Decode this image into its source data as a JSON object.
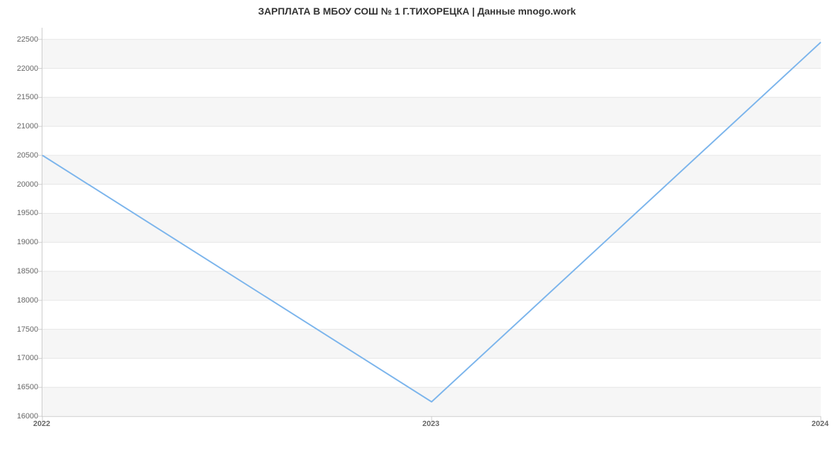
{
  "chart_data": {
    "type": "line",
    "title": "ЗАРПЛАТА В МБОУ СОШ № 1 Г.ТИХОРЕЦКА | Данные mnogo.work",
    "x": [
      2022,
      2023,
      2024
    ],
    "values": [
      20500,
      16250,
      22450
    ],
    "xlabel": "",
    "ylabel": "",
    "y_ticks": [
      16000,
      16500,
      17000,
      17500,
      18000,
      18500,
      19000,
      19500,
      20000,
      20500,
      21000,
      21500,
      22000,
      22500
    ],
    "x_ticks": [
      2022,
      2023,
      2024
    ],
    "ylim": [
      16000,
      22700
    ],
    "xlim": [
      2022,
      2024
    ],
    "line_color": "#7cb5ec"
  }
}
